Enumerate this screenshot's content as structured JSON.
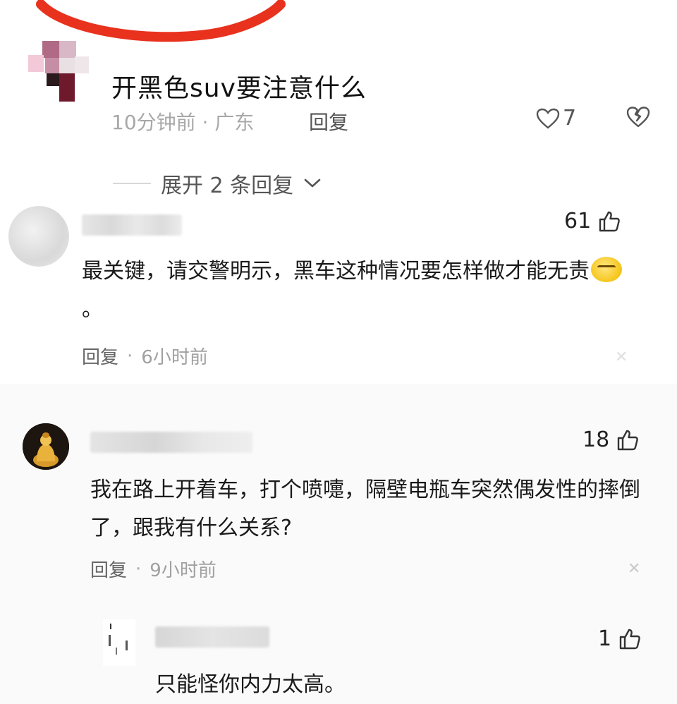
{
  "post": {
    "title": "开黑色suv要注意什么",
    "meta": "10分钟前 · 广东",
    "reply_label": "回复",
    "likes": "7"
  },
  "expand": {
    "label": "展开 2 条回复"
  },
  "comments": [
    {
      "likes": "61",
      "text": "最关键，请交警明示，黑车这种情况要怎样做才能无责",
      "text_end": "。",
      "reply_label": "回复",
      "dot": "·",
      "time": "6小时前"
    },
    {
      "likes": "18",
      "text": "我在路上开着车，打个喷嚏，隔壁电瓶车突然偶发性的摔倒了，跟我有什么关系?",
      "reply_label": "回复",
      "dot": "·",
      "time": "9小时前"
    },
    {
      "likes": "1",
      "text": "只能怪你内力太高。"
    }
  ],
  "colors": {
    "accent_red": "#e8321e",
    "muted_text": "#a8a8a8"
  },
  "icons": {
    "heart": "heart-icon",
    "broken_heart": "broken-heart-icon",
    "thumb": "thumbs-up-icon",
    "chevron": "chevron-down-icon",
    "close": "close-icon"
  }
}
